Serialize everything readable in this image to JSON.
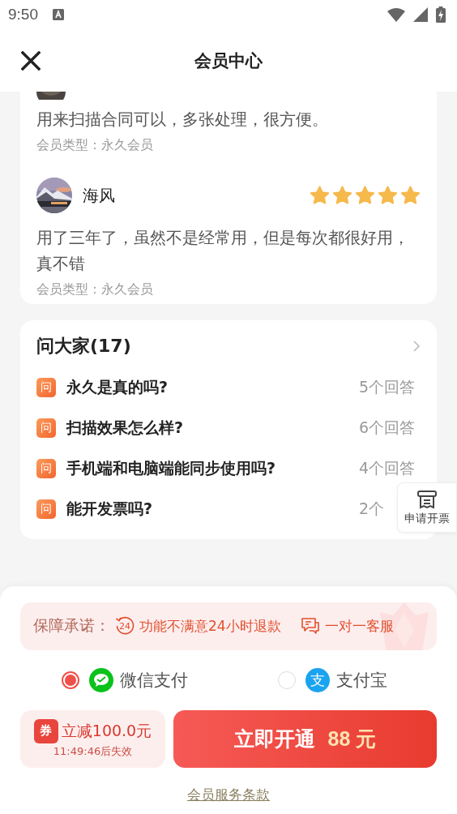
{
  "status_bar": {
    "time": "9:50"
  },
  "header": {
    "title": "会员中心"
  },
  "reviews": [
    {
      "text": "用来扫描合同可以，多张处理，很方便。",
      "meta": "会员类型：永久会员"
    },
    {
      "name": "海风",
      "stars": 5,
      "text": "用了三年了，虽然不是经常用，但是每次都很好用，真不错",
      "meta": "会员类型：永久会员"
    }
  ],
  "questions": {
    "title": "问大家(17)",
    "items": [
      {
        "badge": "问",
        "text": "永久是真的吗?",
        "answers": "5个回答"
      },
      {
        "badge": "问",
        "text": "扫描效果怎么样?",
        "answers": "6个回答"
      },
      {
        "badge": "问",
        "text": "手机端和电脑端能同步使用吗?",
        "answers": "4个回答"
      },
      {
        "badge": "问",
        "text": "能开发票吗?",
        "answers": "2个"
      }
    ]
  },
  "invoice_button": {
    "label": "申请开票"
  },
  "guarantee": {
    "label": "保障承诺：",
    "items": [
      {
        "kind": "refund",
        "text": "功能不满意24小时退款",
        "icon_text": "24"
      },
      {
        "kind": "service",
        "text": "一对一客服"
      }
    ]
  },
  "payment_methods": [
    {
      "kind": "wechat",
      "label": "微信支付",
      "selected": true
    },
    {
      "kind": "alipay",
      "label": "支付宝",
      "selected": false,
      "icon_text": "支"
    }
  ],
  "coupon": {
    "badge": "券",
    "amount": "立减100.0元",
    "expiry": "11:49:46后失效"
  },
  "buy_button": {
    "label": "立即开通",
    "price": "88 元"
  },
  "terms_link": "会员服务条款"
}
